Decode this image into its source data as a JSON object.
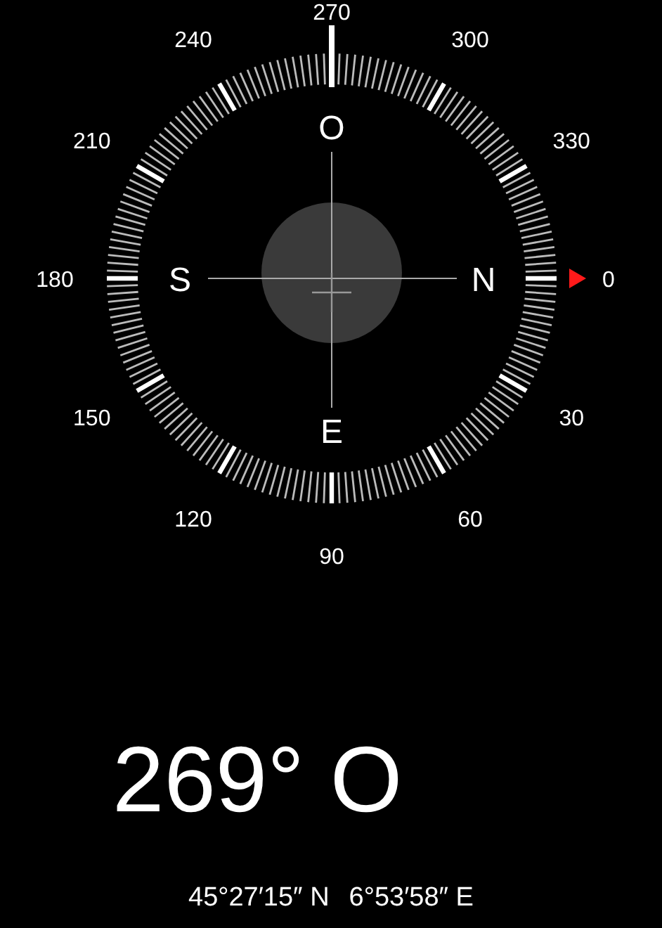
{
  "dial": {
    "degree_labels": [
      {
        "value": "0"
      },
      {
        "value": "30"
      },
      {
        "value": "60"
      },
      {
        "value": "90"
      },
      {
        "value": "120"
      },
      {
        "value": "150"
      },
      {
        "value": "180"
      },
      {
        "value": "210"
      },
      {
        "value": "240"
      },
      {
        "value": "270"
      },
      {
        "value": "300"
      },
      {
        "value": "330"
      }
    ],
    "cardinal_labels": [
      {
        "value": "N"
      },
      {
        "value": "E"
      },
      {
        "value": "S"
      },
      {
        "value": "O"
      }
    ]
  },
  "heading": "269° O",
  "coordinates": {
    "latitude": "45°27′15″ N",
    "longitude": "6°53′58″ E"
  }
}
